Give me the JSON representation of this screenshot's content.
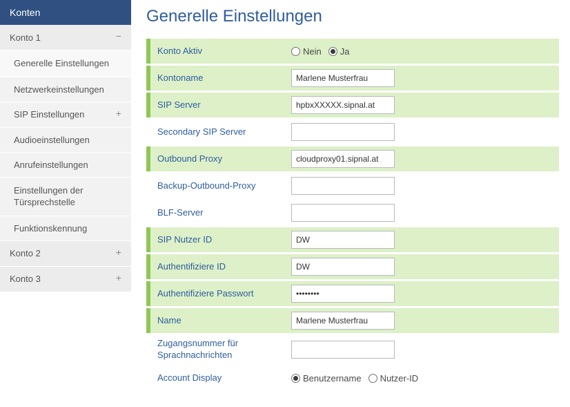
{
  "sidebar": {
    "header": "Konten",
    "items": [
      {
        "label": "Konto 1",
        "icon": "minus"
      },
      {
        "label": "Generelle Einstellungen"
      },
      {
        "label": "Netzwerkeinstellungen"
      },
      {
        "label": "SIP Einstellungen",
        "icon": "plus"
      },
      {
        "label": "Audioeinstellungen"
      },
      {
        "label": "Anrufeinstellungen"
      },
      {
        "label": "Einstellungen der Türsprechstelle"
      },
      {
        "label": "Funktionskennung"
      },
      {
        "label": "Konto 2",
        "icon": "plus"
      },
      {
        "label": "Konto 3",
        "icon": "plus"
      }
    ]
  },
  "page": {
    "title": "Generelle Einstellungen"
  },
  "form": {
    "konto_aktiv": {
      "label": "Konto Aktiv",
      "options": {
        "nein": "Nein",
        "ja": "Ja"
      },
      "selected": "ja",
      "highlight": true
    },
    "kontoname": {
      "label": "Kontoname",
      "value": "Marlene Musterfrau",
      "highlight": true
    },
    "sip_server": {
      "label": "SIP Server",
      "value": "hpbxXXXXX.sipnal.at",
      "highlight": true
    },
    "secondary_sip_server": {
      "label": "Secondary SIP Server",
      "value": "",
      "highlight": false
    },
    "outbound_proxy": {
      "label": "Outbound Proxy",
      "value": "cloudproxy01.sipnal.at",
      "highlight": true
    },
    "backup_outbound_proxy": {
      "label": "Backup-Outbound-Proxy",
      "value": "",
      "highlight": false
    },
    "blf_server": {
      "label": "BLF-Server",
      "value": "",
      "highlight": false
    },
    "sip_nutzer_id": {
      "label": "SIP Nutzer ID",
      "value": "DW",
      "highlight": true
    },
    "auth_id": {
      "label": "Authentifiziere ID",
      "value": "DW",
      "highlight": true
    },
    "auth_passwort": {
      "label": "Authentifiziere Passwort",
      "value": "••••••••",
      "highlight": true
    },
    "name": {
      "label": "Name",
      "value": "Marlene Musterfrau",
      "highlight": true
    },
    "zugangsnummer": {
      "label": "Zugangsnummer für Sprachnachrichten",
      "value": "",
      "highlight": false
    },
    "account_display": {
      "label": "Account Display",
      "options": {
        "benutzername": "Benutzername",
        "nutzer_id": "Nutzer-ID"
      },
      "selected": "benutzername",
      "highlight": false
    }
  }
}
